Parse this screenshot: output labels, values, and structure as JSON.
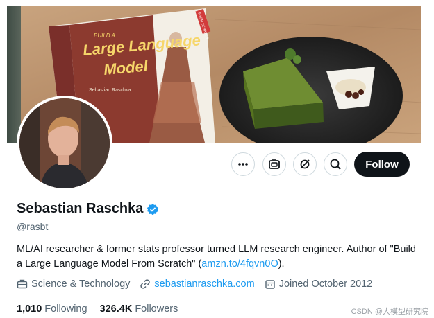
{
  "banner": {
    "book": {
      "top_label": "BUILD A",
      "title_line1": "Large Language",
      "title_line2": "Model",
      "author": "Sebastian Raschka",
      "badge": "FROM SCRATCH"
    }
  },
  "profile": {
    "display_name": "Sebastian Raschka",
    "handle": "@rasbt",
    "bio_text": "ML/AI researcher & former stats professor turned LLM research engineer. Author of \"Build a Large Language Model From Scratch\" (",
    "bio_link": "amzn.to/4fqvn0O",
    "bio_suffix": ").",
    "category": "Science & Technology",
    "website": "sebastianraschka.com",
    "joined": "Joined October 2012",
    "following_count": "1,010",
    "following_label": "Following",
    "followers_count": "326.4K",
    "followers_label": "Followers"
  },
  "actions": {
    "follow_label": "Follow",
    "more_icon": "more-icon",
    "grok_icon": "grok-icon",
    "notifications_icon": "notification-off-icon",
    "search_icon": "search-icon"
  },
  "colors": {
    "accent": "#1d9bf0",
    "text": "#0f1419",
    "muted": "#536471",
    "button_dark": "#0f1419"
  },
  "watermark": "CSDN @大模型研究院"
}
